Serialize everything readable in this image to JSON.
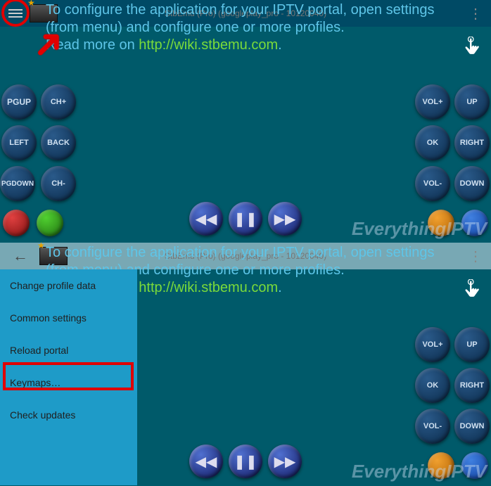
{
  "titlebar_text": "StbEmu (Pro) (googleplay_pro - 10120040)",
  "info": {
    "line1": "To configure the application for your IPTV portal, open settings",
    "line2": "(from menu) and configure one or more profiles.",
    "line3": "Read more on ",
    "link": "http://wiki.stbemu.com"
  },
  "watermark": "EverythingIPTV",
  "left_buttons": {
    "pgup": "PGUP",
    "chplus": "CH+",
    "left": "LEFT",
    "back": "BACK",
    "pgdown": "PGDOWN",
    "chminus": "CH-"
  },
  "right_buttons": {
    "volplus": "VOL+",
    "up": "UP",
    "ok": "OK",
    "right": "RIGHT",
    "volminus": "VOL-",
    "down": "DOWN"
  },
  "media": {
    "rew": "◀◀",
    "pause": "❚❚",
    "fwd": "▶▶"
  },
  "menu": {
    "items": [
      "Change profile data",
      "Common settings",
      "Reload portal",
      "Keymaps…",
      "Check updates"
    ]
  }
}
